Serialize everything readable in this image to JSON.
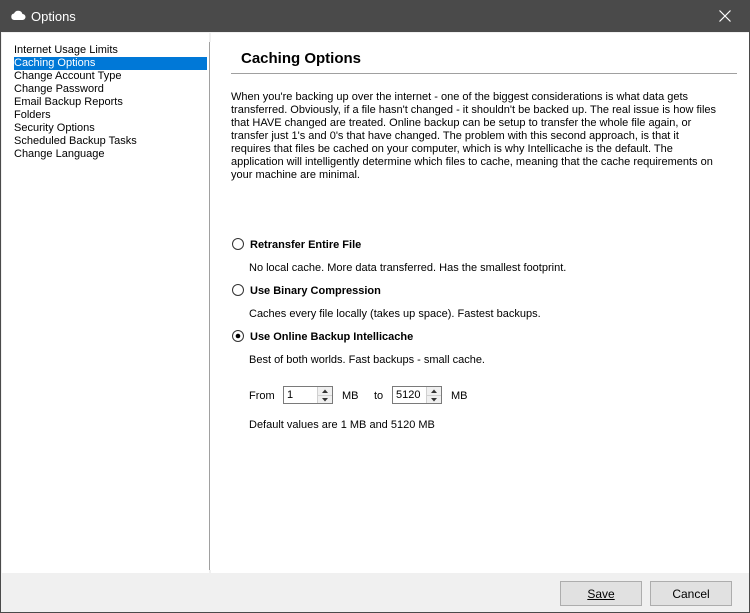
{
  "window": {
    "title": "Options",
    "icon": "cloud-icon",
    "close_icon": "close-icon"
  },
  "sidebar": {
    "items": [
      {
        "label": "Internet Usage Limits"
      },
      {
        "label": "Caching Options",
        "selected": true
      },
      {
        "label": "Change Account Type"
      },
      {
        "label": "Change Password"
      },
      {
        "label": "Email Backup Reports"
      },
      {
        "label": "Folders"
      },
      {
        "label": "Security Options"
      },
      {
        "label": "Scheduled Backup Tasks"
      },
      {
        "label": "Change Language"
      }
    ]
  },
  "main": {
    "title": "Caching Options",
    "description": "When you're backing up over the internet - one of the biggest considerations is what data gets transferred. Obviously, if a file hasn't changed - it shouldn't be backed up. The real issue is how files that HAVE changed are treated. Online backup can be setup to transfer the whole file again, or transfer just 1's and 0's that have changed. The problem with this second approach, is that it requires that files be cached on your computer, which is why Intellicache is the default. The application will intelligently determine which files to cache, meaning that the cache requirements on your machine are minimal.",
    "options": [
      {
        "label": "Retransfer Entire File",
        "description": "No local cache. More data transferred. Has the smallest footprint.",
        "selected": false
      },
      {
        "label": "Use Binary Compression",
        "description": "Caches every file locally (takes up space). Fastest backups.",
        "selected": false
      },
      {
        "label": "Use Online Backup Intellicache",
        "description": "Best of both worlds. Fast backups - small cache.",
        "selected": true
      }
    ],
    "range": {
      "from_label": "From",
      "from_value": "1",
      "unit1": "MB",
      "to_label": "to",
      "to_value": "5120",
      "unit2": "MB",
      "note": "Default values are 1 MB and 5120 MB"
    }
  },
  "footer": {
    "save_label": "Save",
    "cancel_label": "Cancel"
  },
  "colors": {
    "titlebar": "#4a4a4a",
    "selection": "#0078d7"
  }
}
